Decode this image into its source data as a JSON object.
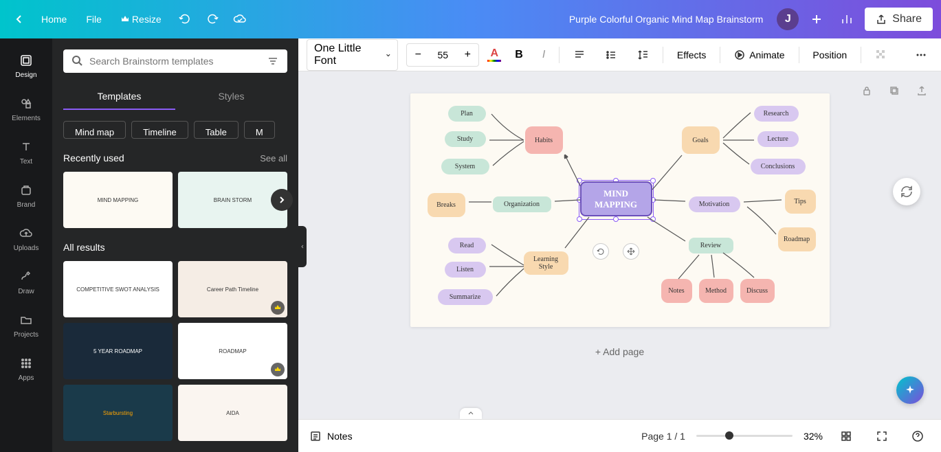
{
  "header": {
    "home": "Home",
    "file": "File",
    "resize": "Resize",
    "doc_title": "Purple Colorful Organic Mind Map Brainstorm",
    "share": "Share",
    "avatar_initial": "J"
  },
  "siderail": {
    "items": [
      {
        "label": "Design",
        "active": true
      },
      {
        "label": "Elements",
        "active": false
      },
      {
        "label": "Text",
        "active": false
      },
      {
        "label": "Brand",
        "active": false
      },
      {
        "label": "Uploads",
        "active": false
      },
      {
        "label": "Draw",
        "active": false
      },
      {
        "label": "Projects",
        "active": false
      },
      {
        "label": "Apps",
        "active": false
      }
    ]
  },
  "sidebar": {
    "search_placeholder": "Search Brainstorm templates",
    "tabs": {
      "templates": "Templates",
      "styles": "Styles"
    },
    "chips": [
      "Mind map",
      "Timeline",
      "Table",
      "M"
    ],
    "recently_used": "Recently used",
    "see_all": "See all",
    "all_results": "All results",
    "thumb_labels": {
      "mindmap": "MIND MAPPING",
      "brainstorm": "BRAIN STORM",
      "swot": "COMPETITIVE SWOT ANALYSIS",
      "career": "Career Path Timeline",
      "roadmap5": "5 YEAR ROADMAP",
      "roadmap": "ROADMAP",
      "starburst": "Starbursting",
      "aida": "AIDA"
    }
  },
  "toolbar": {
    "font_name": "One Little Font",
    "font_size": "55",
    "effects": "Effects",
    "animate": "Animate",
    "position": "Position"
  },
  "canvas": {
    "center": "MIND\nMAPPING",
    "nodes": {
      "plan": "Plan",
      "study": "Study",
      "system": "System",
      "habits": "Habits",
      "breaks": "Breaks",
      "organization": "Organization",
      "read": "Read",
      "listen": "Listen",
      "summarize": "Summarize",
      "learning_style": "Learning\nStyle",
      "goals": "Goals",
      "research": "Research",
      "lecture": "Lecture",
      "conclusions": "Conclusions",
      "motivation": "Motivation",
      "tips": "Tips",
      "roadmap": "Roadmap",
      "review": "Review",
      "notes": "Notes",
      "method": "Method",
      "discuss": "Discuss"
    },
    "add_page": "+ Add page"
  },
  "footer": {
    "notes": "Notes",
    "page_indicator": "Page 1 / 1",
    "zoom": "32%"
  }
}
